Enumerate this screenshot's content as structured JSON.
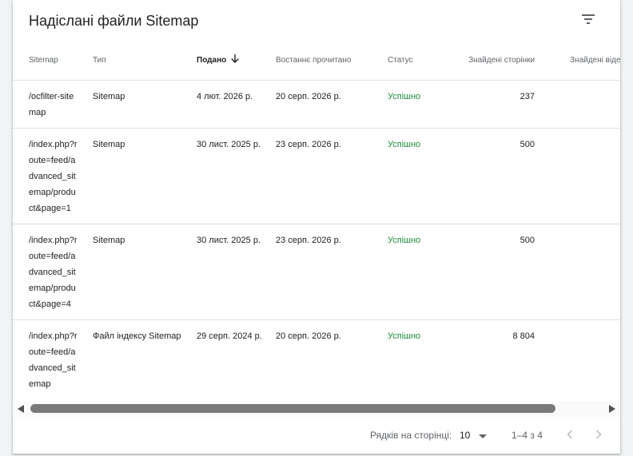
{
  "card": {
    "title": "Надіслані файли Sitemap",
    "filter_icon": "filter-list-icon"
  },
  "table": {
    "columns": [
      {
        "key": "sitemap",
        "label": "Sitemap"
      },
      {
        "key": "type",
        "label": "Тип"
      },
      {
        "key": "submitted",
        "label": "Подано",
        "sorted": "descending"
      },
      {
        "key": "last_read",
        "label": "Востаннє прочитано"
      },
      {
        "key": "status",
        "label": "Статус"
      },
      {
        "key": "pages",
        "label": "Знайдені сторінки"
      },
      {
        "key": "videos",
        "label": "Знайдені відео"
      }
    ],
    "rows": [
      {
        "sitemap": "/ocfilter-sitemap",
        "type": "Sitemap",
        "submitted": "4 лют. 2026 р.",
        "last_read": "20 серп. 2026 р.",
        "status": "Успішно",
        "pages": "237"
      },
      {
        "sitemap": "/index.php?route=feed/advanced_sitemap/product&page=1",
        "type": "Sitemap",
        "submitted": "30 лист. 2025 р.",
        "last_read": "23 серп. 2026 р.",
        "status": "Успішно",
        "pages": "500"
      },
      {
        "sitemap": "/index.php?route=feed/advanced_sitemap/product&page=4",
        "type": "Sitemap",
        "submitted": "30 лист. 2025 р.",
        "last_read": "23 серп. 2026 р.",
        "status": "Успішно",
        "pages": "500"
      },
      {
        "sitemap": "/index.php?route=feed/advanced_sitemap",
        "type": "Файл індексу Sitemap",
        "submitted": "29 серп. 2024 р.",
        "last_read": "20 серп. 2026 р.",
        "status": "Успішно",
        "pages": "8 804"
      }
    ]
  },
  "pagination": {
    "rows_per_page_label": "Рядків на сторінці:",
    "rows_per_page_value": "10",
    "range": "1–4 з 4"
  },
  "colors": {
    "status_success": "#1e8e3e",
    "scroll_thumb": "#7a7a7a"
  }
}
